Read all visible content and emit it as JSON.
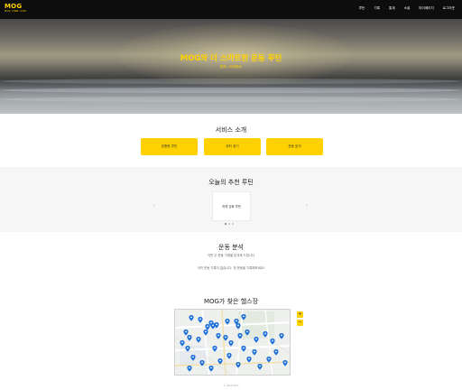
{
  "header": {
    "logo": "MOG",
    "logo_sub": "MOV. OWN. GYM.",
    "nav": [
      "루틴",
      "기록",
      "통계",
      "소셜",
      "마이페이지",
      "로그아웃"
    ]
  },
  "hero": {
    "title": "MOG와 더 스마트한 운동 루틴",
    "subtitle": "함께 시작해봐요"
  },
  "services": {
    "title": "서비스 소개",
    "buttons": [
      "맞춤형 루틴",
      "위치 찾기",
      "운동 분석"
    ]
  },
  "recommend": {
    "title": "오늘의 추천 루틴",
    "card": "하체 강화 루틴",
    "prev_icon": "chevron-left-icon",
    "next_icon": "chevron-right-icon",
    "slides": 3,
    "active_slide": 1
  },
  "analysis": {
    "title": "운동 분석",
    "subtitle": "이번 주 운동 기록을 분석해 드립니다",
    "message": "아직 운동 기록이 없습니다. 첫 운동을 기록해보세요!"
  },
  "gyms": {
    "title": "MOG가 찾은 헬스장",
    "zoom_in": "+",
    "zoom_out": "−",
    "marker_color": "#1e6fd9"
  },
  "footer": {
    "text": "© 2024 MOG"
  },
  "colors": {
    "accent": "#ffd100",
    "nav_bg": "#0d0d0d"
  }
}
